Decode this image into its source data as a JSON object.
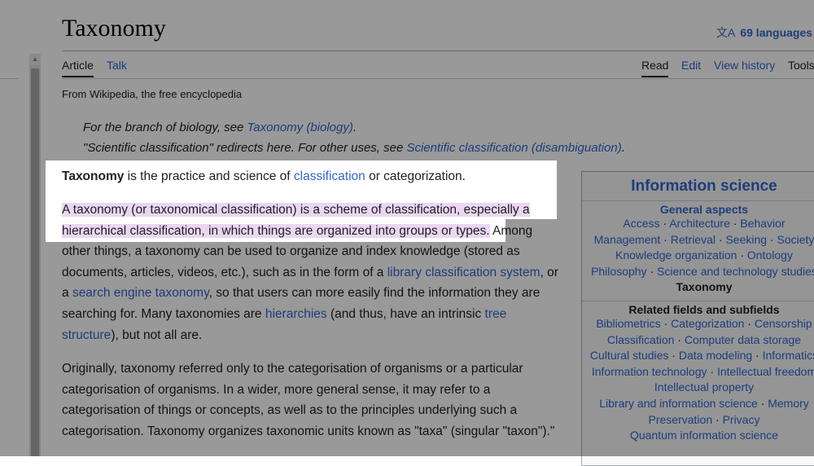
{
  "page": {
    "title": "Taxonomy",
    "languages": "69 languages",
    "tabs_left": [
      "Article",
      "Talk"
    ],
    "tabs_right": [
      "Read",
      "Edit",
      "View history",
      "Tools"
    ],
    "tagline": "From Wikipedia, the free encyclopedia"
  },
  "hatnotes": [
    {
      "pre": "For the branch of biology, see ",
      "link": "Taxonomy (biology)",
      "post": "."
    },
    {
      "pre": "\"Scientific classification\" redirects here. For other uses, see ",
      "link": "Scientific classification (disambiguation)",
      "post": "."
    }
  ],
  "lead": {
    "bold": "Taxonomy",
    "t1": " is the practice and science of ",
    "link": "classification",
    "t2": " or categorization."
  },
  "para1": {
    "highlight": "A taxonomy (or taxonomical classification) is a scheme of classification, especially a hierarchical classification, in which things are organized into groups or types.",
    "t1": " Among other things, a taxonomy can be used to organize and index knowledge (stored as documents, articles, videos, etc.), such as in the form of a ",
    "l1": "library classification system",
    "t2": ", or a ",
    "l2": "search engine taxonomy",
    "t3": ", so that users can more easily find the information they are searching for. Many taxonomies are ",
    "l3": "hierarchies",
    "t4": " (and thus, have an intrinsic ",
    "l4": "tree structure",
    "t5": "), but not all are."
  },
  "para2": "Originally, taxonomy referred only to the categorisation of organisms or a particular categorisation of organisms. In a wider, more general sense, it may refer to a categorisation of things or concepts, as well as to the principles underlying such a categorisation. Taxonomy organizes taxonomic units known as \"taxa\" (singular \"taxon\").\"",
  "infobox": {
    "title": "Information science",
    "general_heading": "General aspects",
    "general_lines": [
      [
        "Access",
        "Architecture",
        "Behavior"
      ],
      [
        "Management",
        "Retrieval",
        "Seeking",
        "Society"
      ],
      [
        "Knowledge organization",
        "Ontology"
      ],
      [
        "Philosophy",
        "Science and technology studies"
      ]
    ],
    "current": "Taxonomy",
    "related_heading": "Related fields and subfields",
    "related_lines": [
      [
        "Bibliometrics",
        "Categorization",
        "Censorship"
      ],
      [
        "Classification",
        "Computer data storage"
      ],
      [
        "Cultural studies",
        "Data modeling",
        "Informatics"
      ],
      [
        "Information technology",
        "Intellectual freedom"
      ],
      [
        "Intellectual property"
      ],
      [
        "Library and information science",
        "Memory"
      ],
      [
        "Preservation",
        "Privacy"
      ],
      [
        "Quantum information science"
      ]
    ]
  },
  "colors": {
    "link": "#3366cc",
    "highlight": "#ecd6f2",
    "overlay": "rgba(0,0,0,0.40)"
  }
}
